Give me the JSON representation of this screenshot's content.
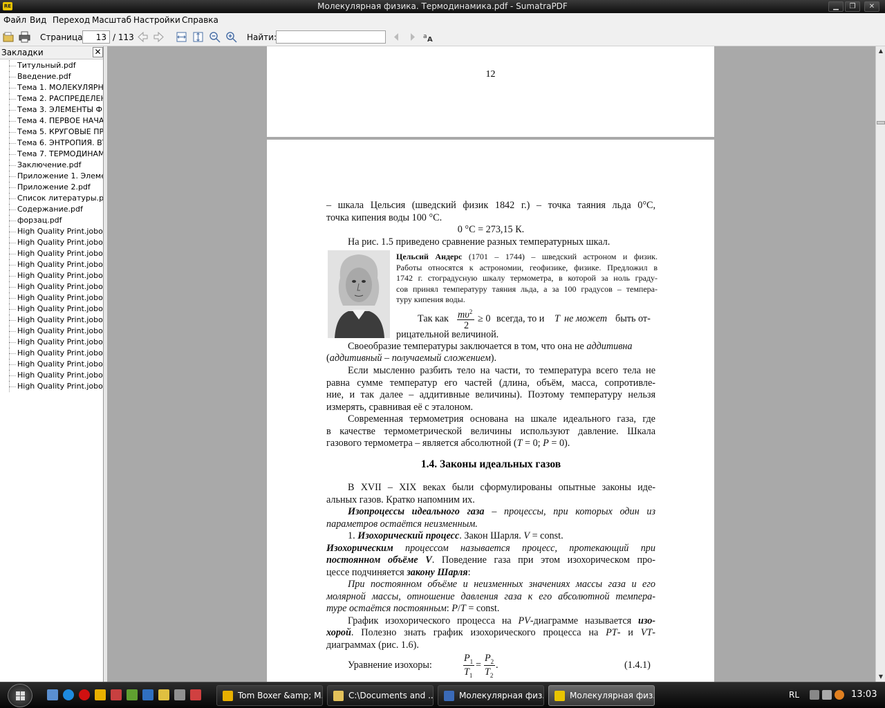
{
  "window": {
    "title": "Молекулярная физика. Термодинамика.pdf - SumatraPDF",
    "app_icon_text": "RE"
  },
  "menu": [
    "Файл",
    "Вид",
    "Переход",
    "Масштаб",
    "Настройки",
    "Справка"
  ],
  "toolbar": {
    "page_label": "Страница:",
    "page_value": "13",
    "page_total": "/ 113",
    "find_label": "Найти:",
    "find_value": ""
  },
  "sidebar": {
    "title": "Закладки",
    "close": "✕",
    "items": [
      "Титульный.pdf",
      "Введение.pdf",
      "Тема 1. МОЛЕКУЛЯРНО-",
      "Тема 2. РАСПРЕДЕЛЕНИ",
      "Тема 3. ЭЛЕМЕНТЫ ФИЗИ",
      "Тема 4. ПЕРВОЕ НАЧАЛО",
      "Тема 5.  КРУГОВЫЕ ПРО",
      "Тема 6. ЭНТРОПИЯ. ВТО",
      "Тема 7. ТЕРМОДИНАМИ",
      "Заключение.pdf",
      "Приложение 1. Элемен",
      "Приложение 2.pdf",
      "Список литературы.pdf",
      "Содержание.pdf",
      "форзац.pdf",
      "High Quality Print.jobop",
      "High Quality Print.jobop",
      "High Quality Print.jobop",
      "High Quality Print.jobop",
      "High Quality Print.jobop",
      "High Quality Print.jobop",
      "High Quality Print.jobop",
      "High Quality Print.jobop",
      "High Quality Print.jobop",
      "High Quality Print.jobop",
      "High Quality Print.jobop",
      "High Quality Print.jobop",
      "High Quality Print.jobop",
      "High Quality Print.jobop",
      "High Quality Print.jobop"
    ]
  },
  "document": {
    "page12_number": "12",
    "l1": "– шкала Цельсия  (шведский физик 1842 г.) – точка  таяния льда 0°C,",
    "l2": "точка кипения воды 100 °C.",
    "l3": "0 °C = 273,15 К.",
    "l4": "На рис. 1.5 приведено сравнение разных температурных шкал.",
    "bio_name": "Цельсий Андерс",
    "bio_1": " (1701 – 1744) – шведский астроном и физик.",
    "bio_2": "Работы относятся к астрономии, геофизике, физике. Предложил в",
    "bio_3": "1742 г. стоградусную шкалу термометра, в которой за ноль граду-",
    "bio_4": "сов принял температуру таяния льда, а за 100 градусов – темпера-",
    "bio_5": "туру кипения воды.",
    "f_so": "Так как",
    "f_num": "mυ",
    "f_sup": "2",
    "f_den": "2",
    "f_ge": "≥ 0",
    "f_rest1": "всегда, то и",
    "f_T": "T",
    "f_ne": "не может",
    "f_rest2": "быть от-",
    "f_line2": "рицательной величиной.",
    "p1a": "Своеобразие температуры заключается в том, что она не",
    "p1b": "аддитивна",
    "p1c": "(",
    "p1d": "аддитивный – получаемый сложением",
    "p1e": ").",
    "p2_1": "Если мысленно разбить тело на части, то температура всего тела не",
    "p2_2": "равна сумме температур его частей (длина, объём, масса, сопротивле-",
    "p2_3": "ние, и так далее – аддитивные величины). Поэтому температуру нельзя",
    "p2_4": "измерять, сравнивая её с эталоном.",
    "p3_1": "Современная термометрия основана на шкале идеального газа, где",
    "p3_2": "в качестве термометрической величины используют давление. Шкала",
    "p3_3a": "газового термометра – является абсолютной (",
    "p3_3b": "T",
    "p3_3c": " = 0; ",
    "p3_3d": "P",
    "p3_3e": " = 0).",
    "heading": "1.4. Законы идеальных газов",
    "p4_1": "В XVII – XIX веках были сформулированы опытные законы иде-",
    "p4_2": "альных газов. Кратко напомним их.",
    "p5_1a": "Изопроцессы идеального газа",
    "p5_1b": " – процессы, при которых один из",
    "p5_2": "параметров остаётся неизменным.",
    "p6a": "1. ",
    "p6b": "Изохорический процесс",
    "p6c": ". Закон Шарля. ",
    "p6d": "V",
    "p6e": " = const.",
    "p7_1a": "Изохорическим",
    "p7_1b": " процессом называется процесс, протекающий при",
    "p7_2a": "постоянном объёме V",
    "p7_2b": ". Поведение газа при этом изохорическом про-",
    "p7_3a": "цессе подчиняется ",
    "p7_3b": "закону Шарля",
    "p7_3c": ":",
    "p8_1": "При постоянном объёме и неизменных значениях массы газа и его",
    "p8_2": "молярной массы, отношение давления газа к его абсолютной темпера-",
    "p8_3a": "туре остаётся постоянным",
    "p8_3b": ": ",
    "p8_3c": "P",
    "p8_3d": "/",
    "p8_3e": "T",
    "p8_3f": " = const.",
    "p9_1a": "График изохорического процесса на ",
    "p9_1b": "PV",
    "p9_1c": "-диаграмме называется ",
    "p9_1d": "изо-",
    "p9_2a": "хорой",
    "p9_2b": ". Полезно знать график изохорического процесса на ",
    "p9_2c": "PT",
    "p9_2d": "- и ",
    "p9_2e": "VT",
    "p9_2f": "-",
    "p9_3": "диаграммах (рис. 1.6).",
    "eq_label": "Уравнение изохоры:",
    "eq_P1": "P",
    "eq_s1": "1",
    "eq_T1": "T",
    "eq_P2": "P",
    "eq_s2": "2",
    "eq_T2": "T",
    "eq_eq": "=",
    "eq_dot": ".",
    "eq_num": "(1.4.1)"
  },
  "taskbar": {
    "buttons": [
      "Tom Boxer &amp; M...",
      "C:\\Documents and ...",
      "Молекулярная физ...",
      "Молекулярная физ..."
    ],
    "lang": "RL",
    "clock": "13:03"
  },
  "colors": {
    "accent_yellow": "#e8c400",
    "taskbar_dark": "#161616",
    "doc_bg": "#a9a9a9"
  }
}
